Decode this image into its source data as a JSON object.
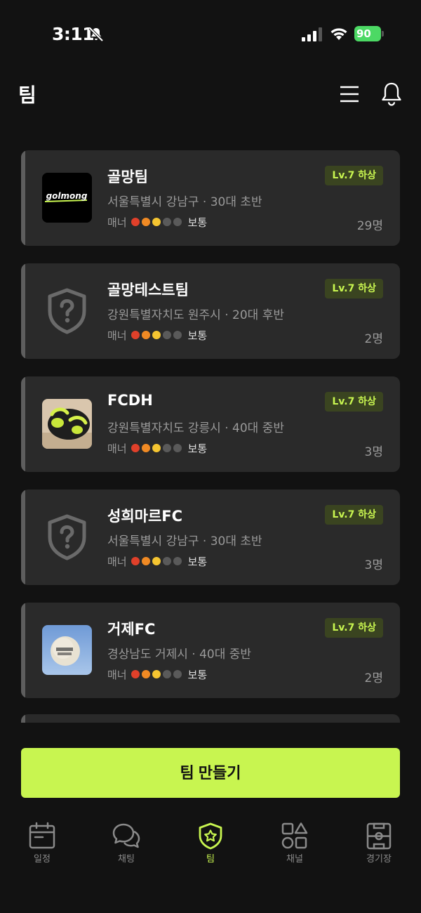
{
  "status": {
    "time": "3:11",
    "battery": "90"
  },
  "header": {
    "title": "팀"
  },
  "teams": [
    {
      "name": "골망팀",
      "info": "서울특별시 강남구 · 30대 초반",
      "manner_label": "매너",
      "manner_value": "보통",
      "level": "Lv.7 하상",
      "members": "29명",
      "logo": "golmong-logo",
      "logo_text": "golmong"
    },
    {
      "name": "골망테스트팀",
      "info": "강원특별자치도 원주시 · 20대 후반",
      "manner_label": "매너",
      "manner_value": "보통",
      "level": "Lv.7 하상",
      "members": "2명",
      "logo": "shield-question-icon"
    },
    {
      "name": "FCDH",
      "info": "강원특별자치도 강릉시 · 40대 중반",
      "manner_label": "매너",
      "manner_value": "보통",
      "level": "Lv.7 하상",
      "members": "3명",
      "logo": "earbuds-photo"
    },
    {
      "name": "성희마르FC",
      "info": "서울특별시 강남구 · 30대 초반",
      "manner_label": "매너",
      "manner_value": "보통",
      "level": "Lv.7 하상",
      "members": "3명",
      "logo": "shield-question-icon"
    },
    {
      "name": "거제FC",
      "info": "경상남도 거제시 · 40대 중반",
      "manner_label": "매너",
      "manner_value": "보통",
      "level": "Lv.7 하상",
      "members": "2명",
      "logo": "balloon-photo"
    }
  ],
  "manner_dots": [
    "#e0402a",
    "#f08a24",
    "#f5c531",
    "#5a5a5a",
    "#5a5a5a"
  ],
  "create_button": "팀 만들기",
  "tabs": [
    {
      "label": "일정",
      "icon": "calendar-icon",
      "active": false
    },
    {
      "label": "채팅",
      "icon": "chat-icon",
      "active": false
    },
    {
      "label": "팀",
      "icon": "team-shield-icon",
      "active": true
    },
    {
      "label": "채널",
      "icon": "shapes-icon",
      "active": false
    },
    {
      "label": "경기장",
      "icon": "field-icon",
      "active": false
    }
  ],
  "colors": {
    "accent": "#c8f550",
    "background": "#121212",
    "card": "#2a2a2a"
  }
}
